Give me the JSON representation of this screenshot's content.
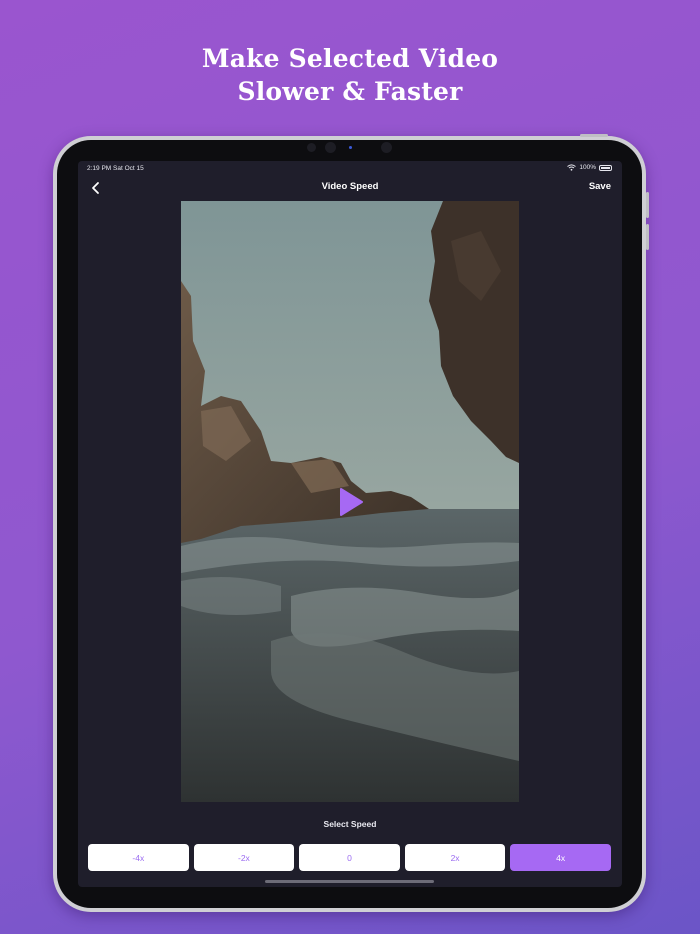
{
  "headline": {
    "line1": "Make Selected Video",
    "line2": "Slower & Faster"
  },
  "status_bar": {
    "time": "2:19 PM   Sat Oct 15",
    "battery": "100%",
    "wifi_icon": "wifi-icon",
    "battery_icon": "battery-icon"
  },
  "nav": {
    "back_icon": "chevron-left-icon",
    "title": "Video Speed",
    "save_label": "Save"
  },
  "video": {
    "play_icon": "play-icon",
    "accent": "#a669f3"
  },
  "speed": {
    "label": "Select Speed",
    "options": [
      "-4x",
      "-2x",
      "0",
      "2x",
      "4x"
    ],
    "selected": "4x"
  },
  "colors": {
    "background_top": "#9a55cf",
    "background_bottom": "#6b55c7",
    "screen": "#1f1e2b",
    "accent": "#a669f3"
  }
}
